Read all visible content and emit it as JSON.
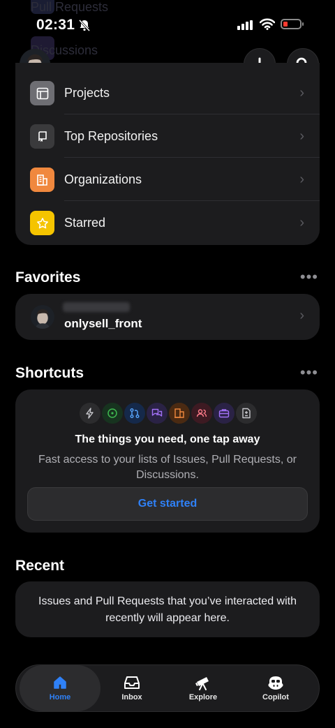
{
  "status_bar": {
    "time": "02:31"
  },
  "ghost_rows": [
    "Pull Requests",
    "Discussions"
  ],
  "menu": {
    "items": [
      {
        "label": "Projects",
        "icon": "table-icon",
        "color": "#6e6e73"
      },
      {
        "label": "Top Repositories",
        "icon": "repo-icon",
        "color": "#3a3a3c"
      },
      {
        "label": "Organizations",
        "icon": "building-icon",
        "color": "#f0883e"
      },
      {
        "label": "Starred",
        "icon": "star-icon",
        "color": "#f5c400"
      }
    ]
  },
  "favorites": {
    "title": "Favorites",
    "items": [
      {
        "label": "onlysell_front"
      }
    ]
  },
  "shortcuts": {
    "title": "Shortcuts",
    "headline": "The things you need, one tap away",
    "description": "Fast access to your lists of Issues, Pull Requests, or Discussions.",
    "button": "Get started"
  },
  "recent": {
    "title": "Recent",
    "empty_text": "Issues and Pull Requests that you’ve interacted with recently will appear here."
  },
  "tabs": [
    {
      "label": "Home",
      "icon": "home-icon",
      "active": true
    },
    {
      "label": "Inbox",
      "icon": "inbox-icon",
      "active": false
    },
    {
      "label": "Explore",
      "icon": "telescope-icon",
      "active": false
    },
    {
      "label": "Copilot",
      "icon": "copilot-icon",
      "active": false
    }
  ],
  "colors": {
    "accent": "#2f81f7",
    "background": "#000000",
    "card": "#1c1c1e"
  }
}
